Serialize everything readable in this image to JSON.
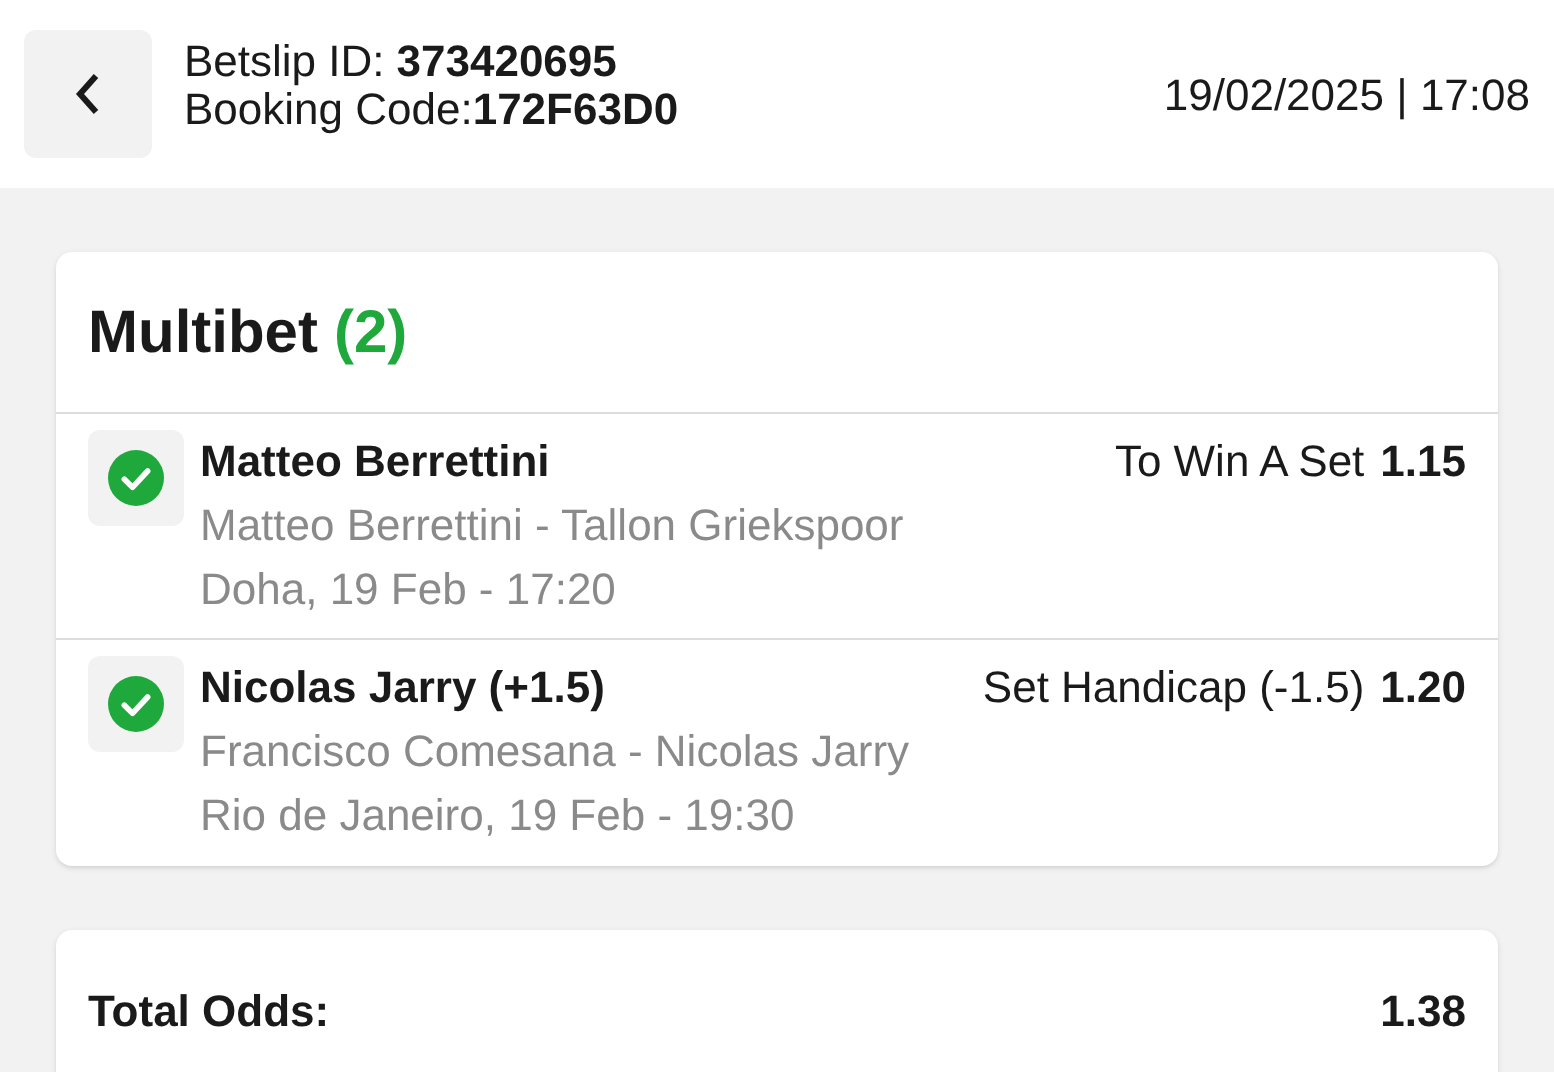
{
  "header": {
    "betslip_label": "Betslip ID:",
    "betslip_id": "373420695",
    "booking_label": "Booking Code:",
    "booking_code": "172F63D0",
    "datetime": "19/02/2025 | 17:08"
  },
  "bet": {
    "title": "Multibet",
    "count": "(2)",
    "selections": [
      {
        "won": true,
        "pick": "Matteo Berrettini",
        "market": "To Win A Set",
        "odds": "1.15",
        "match": "Matteo Berrettini - Tallon Griekspoor",
        "info": "Doha, 19 Feb - 17:20"
      },
      {
        "won": true,
        "pick": "Nicolas Jarry (+1.5)",
        "market": "Set Handicap (-1.5)",
        "odds": "1.20",
        "match": "Francisco Comesana - Nicolas Jarry",
        "info": "Rio de Janeiro, 19 Feb - 19:30"
      }
    ]
  },
  "summary": {
    "total_label": "Total Odds:",
    "total_odds": "1.38"
  }
}
